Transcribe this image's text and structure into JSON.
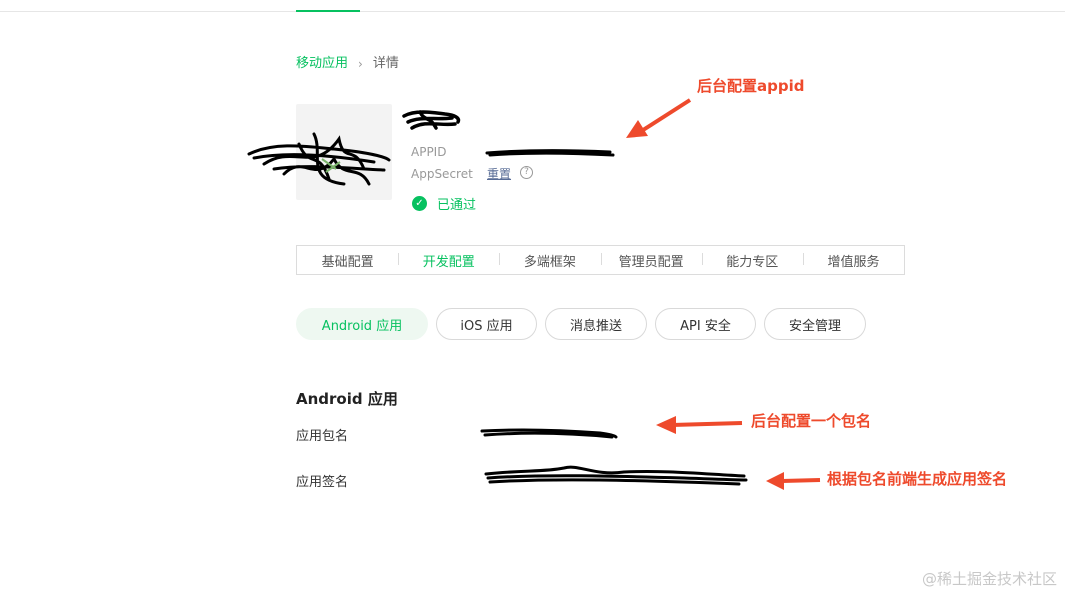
{
  "top_nav": {},
  "breadcrumb": {
    "parent": "移动应用",
    "separator": "›",
    "current": "详情"
  },
  "app_info": {
    "appid_label": "APPID",
    "appsecret_label": "AppSecret",
    "reset_link": "重置",
    "help_icon": "question-circle-icon",
    "status_text": "已通过",
    "status_icon": "check-circle-icon"
  },
  "tabs": [
    {
      "label": "基础配置",
      "active": false
    },
    {
      "label": "开发配置",
      "active": true
    },
    {
      "label": "多端框架",
      "active": false
    },
    {
      "label": "管理员配置",
      "active": false
    },
    {
      "label": "能力专区",
      "active": false
    },
    {
      "label": "增值服务",
      "active": false
    }
  ],
  "platform_pills": [
    {
      "label": "Android 应用",
      "active": true
    },
    {
      "label": "iOS 应用",
      "active": false
    },
    {
      "label": "消息推送",
      "active": false
    },
    {
      "label": "API 安全",
      "active": false
    },
    {
      "label": "安全管理",
      "active": false
    }
  ],
  "android_section": {
    "title": "Android 应用",
    "package_label": "应用包名",
    "signature_label": "应用签名"
  },
  "annotations": {
    "appid_note": "后台配置appid",
    "package_note": "后台配置一个包名",
    "signature_note": "根据包名前端生成应用签名"
  },
  "watermark": "@稀土掘金技术社区",
  "colors": {
    "accent": "#07c160",
    "annotation": "#ee4a2c",
    "link": "#576b95"
  }
}
